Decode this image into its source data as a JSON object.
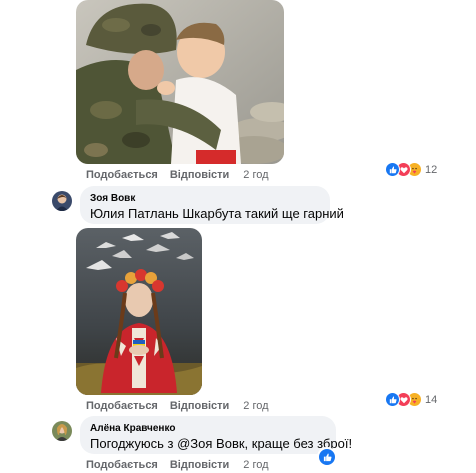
{
  "comments": [
    {
      "image_alt": "soldier-with-child-photo",
      "actions": {
        "like_label": "Подобається",
        "reply_label": "Відповісти",
        "time": "2 год"
      },
      "reactions": {
        "types": [
          "like-icon",
          "love-icon",
          "care-icon"
        ],
        "count": "12"
      }
    },
    {
      "author": "Зоя Вовк",
      "text": "Юлия Патлань Шкарбута такий ще гарний"
    },
    {
      "image_alt": "woman-in-wreath-with-cranes-art",
      "actions": {
        "like_label": "Подобається",
        "reply_label": "Відповісти",
        "time": "2 год"
      },
      "reactions": {
        "types": [
          "like-icon",
          "love-icon",
          "care-icon"
        ],
        "count": "14"
      }
    },
    {
      "author": "Алёна Кравченко",
      "text": "Погоджуюсь з @Зоя Вовк, краще без зброї!",
      "actions": {
        "like_label": "Подобається",
        "reply_label": "Відповісти",
        "time": "2 год"
      },
      "reactions": {
        "types": [
          "like-icon"
        ]
      }
    }
  ],
  "colors": {
    "like_blue": "#1877f2",
    "love_red": "#f33e58",
    "care_yellow": "#f7b125",
    "bubble_bg": "#f0f2f5",
    "meta_gray": "#65676b"
  }
}
